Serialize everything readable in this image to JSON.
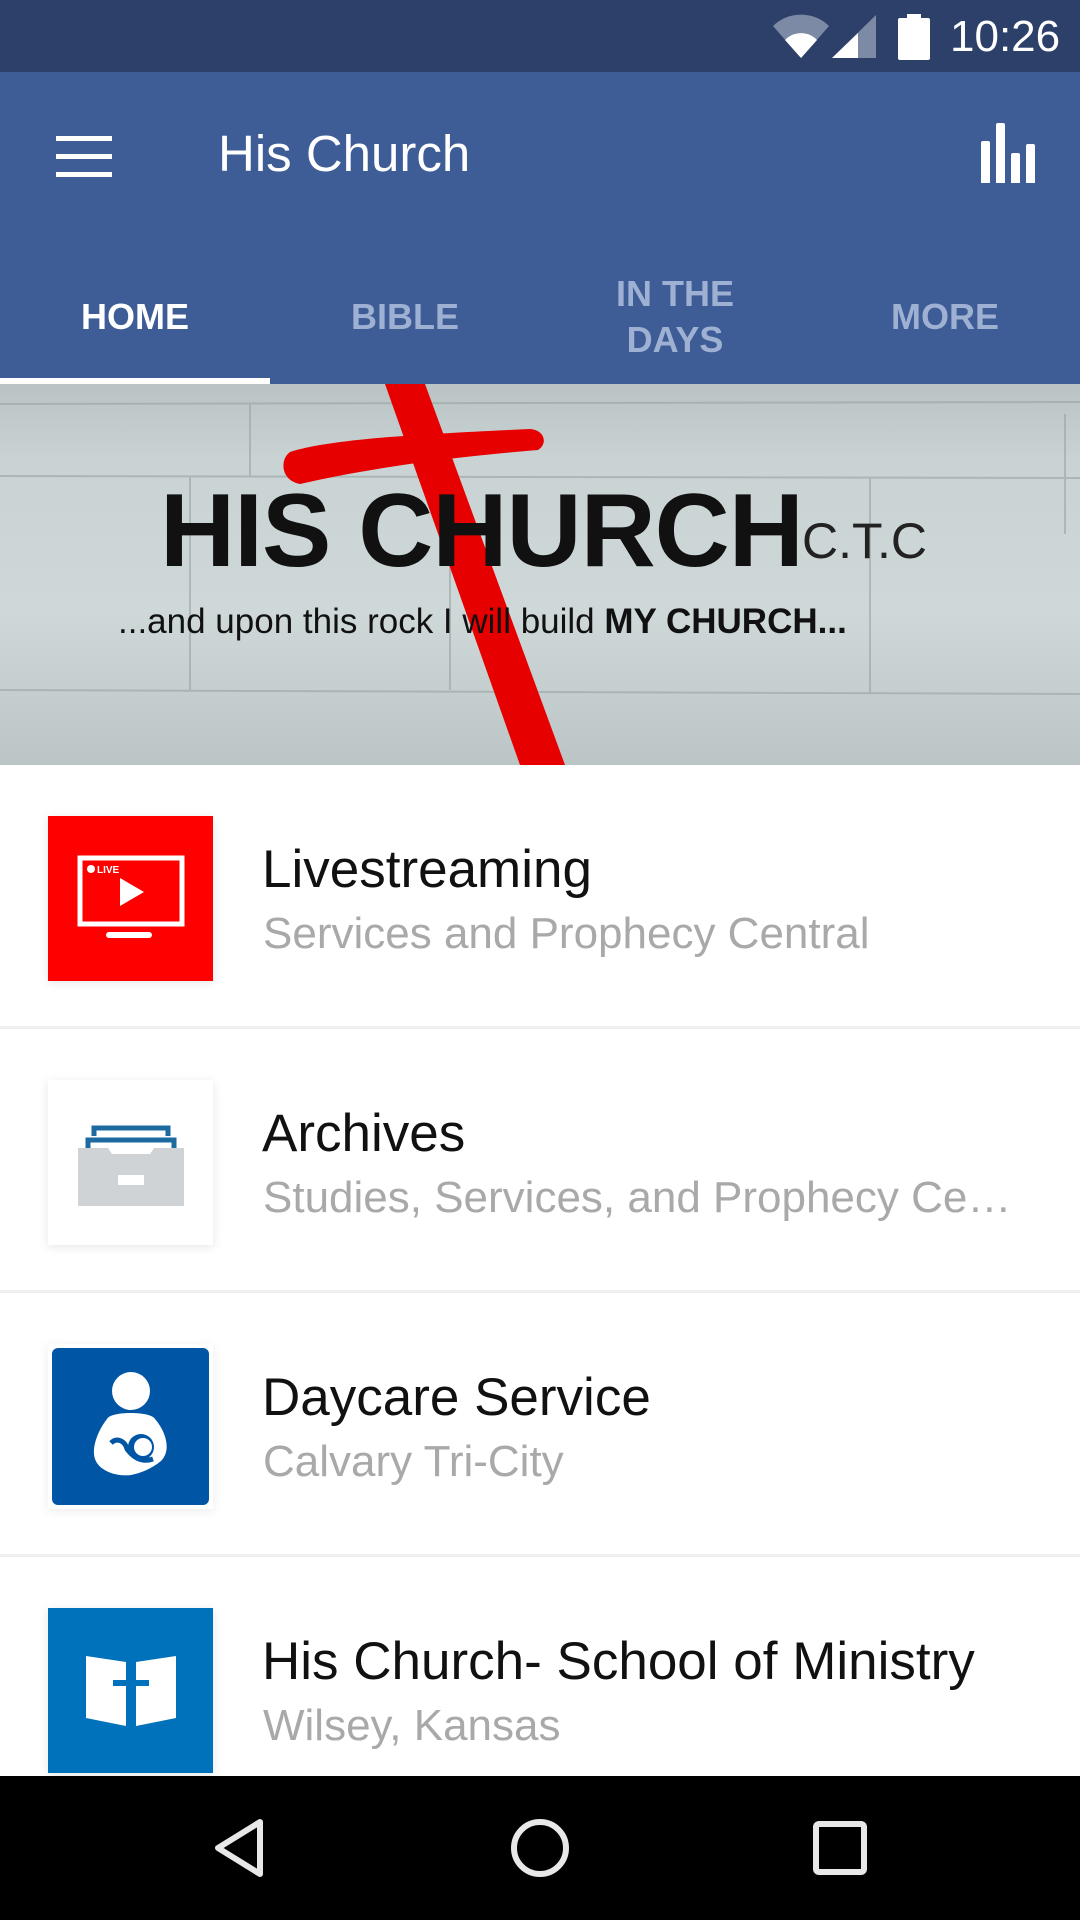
{
  "status_bar": {
    "time": "10:26",
    "icons": [
      "wifi-icon",
      "cell-signal-icon",
      "battery-icon"
    ]
  },
  "app_bar": {
    "menu_icon": "hamburger-menu-icon",
    "title": "His Church",
    "action_icon": "bar-chart-icon"
  },
  "tabs": [
    {
      "label": "HOME",
      "active": true
    },
    {
      "label": "BIBLE",
      "active": false
    },
    {
      "label": "IN THE\nDAYS",
      "active": false
    },
    {
      "label": "MORE",
      "active": false
    }
  ],
  "banner": {
    "title": "HIS CHURCH",
    "suffix": "C.T.C",
    "tagline_plain": "...and upon this rock I will build ",
    "tagline_bold": "MY CHURCH..."
  },
  "list": [
    {
      "title": "Livestreaming",
      "subtitle": "Services and Prophecy Central",
      "icon": "live-tv-icon",
      "icon_bg": "#ff0000",
      "icon_badge": "LIVE"
    },
    {
      "title": "Archives",
      "subtitle": "Studies, Services, and Prophecy Central",
      "icon": "archive-drawer-icon",
      "icon_bg": "#ffffff"
    },
    {
      "title": "Daycare Service",
      "subtitle": "Calvary Tri-City",
      "icon": "mother-child-icon",
      "icon_bg": "#0055a5"
    },
    {
      "title": "His Church- School of Ministry",
      "subtitle": "Wilsey, Kansas",
      "icon": "bible-cross-icon",
      "icon_bg": "#0072bb"
    }
  ],
  "nav_bar": {
    "buttons": [
      "back-icon",
      "home-icon",
      "recents-icon"
    ]
  },
  "colors": {
    "status_bar": "#2c4069",
    "app_bar": "#3e5c96",
    "tab_inactive": "#9fb1d3",
    "subtitle": "#a9a9a9"
  }
}
